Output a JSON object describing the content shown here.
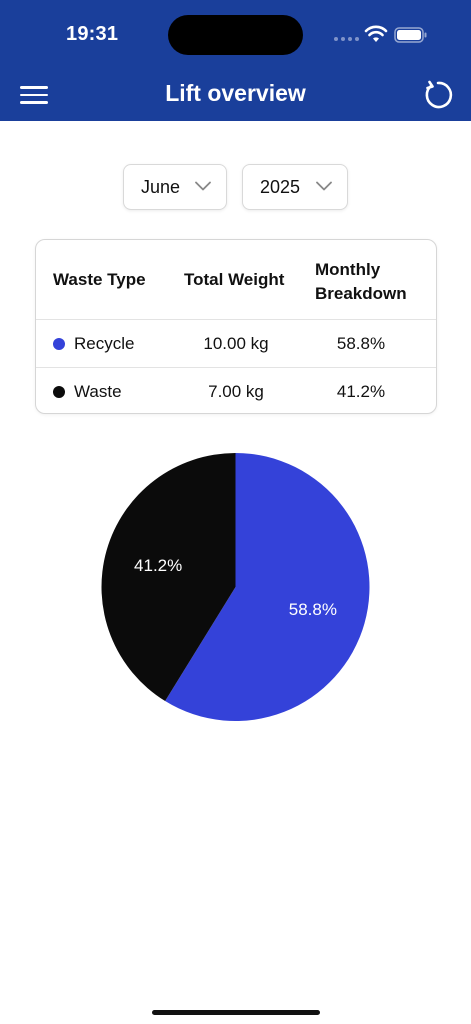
{
  "status_bar": {
    "time": "19:31"
  },
  "header": {
    "title": "Lift overview"
  },
  "filters": {
    "month": "June",
    "year": "2025"
  },
  "table": {
    "headers": {
      "type": "Waste Type",
      "weight": "Total Weight",
      "breakdown_line1": "Monthly",
      "breakdown_line2": "Breakdown"
    },
    "rows": [
      {
        "type": "Recycle",
        "weight": "10.00 kg",
        "percent": "58.8%",
        "color": "#3442d9"
      },
      {
        "type": "Waste",
        "weight": "7.00 kg",
        "percent": "41.2%",
        "color": "#0b0b0b"
      }
    ]
  },
  "colors": {
    "header_bg": "#1a3f9b",
    "recycle": "#3442d9",
    "waste": "#0b0b0b"
  },
  "icons": [
    "menu-icon",
    "refresh-icon",
    "chevron-down-icon",
    "wifi-icon",
    "battery-icon"
  ],
  "chart_data": {
    "type": "pie",
    "categories": [
      "Recycle",
      "Waste"
    ],
    "values": [
      58.8,
      41.2
    ],
    "labels": [
      "58.8%",
      "41.2%"
    ],
    "colors": [
      "#3442d9",
      "#0b0b0b"
    ]
  }
}
